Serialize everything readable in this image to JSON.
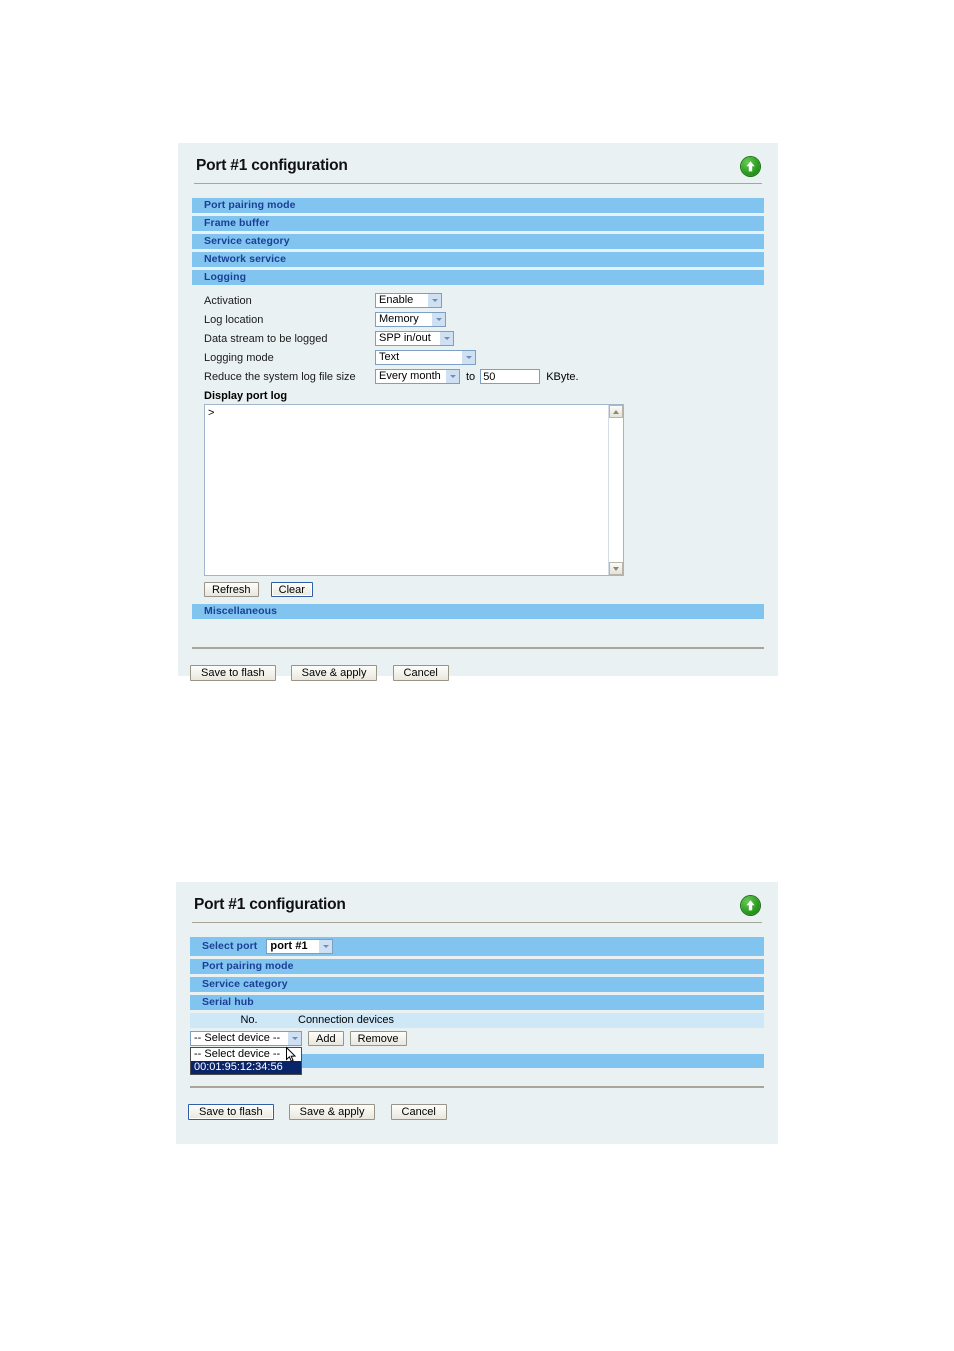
{
  "panels": {
    "logging": {
      "title": "Port #1 configuration",
      "up_icon": "up-arrow-icon",
      "sections": [
        {
          "label": "Port pairing mode"
        },
        {
          "label": "Frame buffer"
        },
        {
          "label": "Service category"
        },
        {
          "label": "Network service"
        },
        {
          "label": "Logging"
        }
      ],
      "fields": {
        "activation": {
          "label": "Activation",
          "value": "Enable"
        },
        "log_location": {
          "label": "Log location",
          "value": "Memory"
        },
        "data_stream": {
          "label": "Data stream to be logged",
          "value": "SPP in/out"
        },
        "logging_mode": {
          "label": "Logging mode",
          "value": "Text"
        },
        "reduce_size": {
          "label": "Reduce the system log file size",
          "period": "Every month",
          "to_label": "to",
          "size_value": "50",
          "unit": "KByte."
        }
      },
      "display_port_log": {
        "label": "Display port log",
        "content": ">",
        "refresh_label": "Refresh",
        "clear_label": "Clear"
      },
      "misc_section": {
        "label": "Miscellaneous"
      },
      "actions": {
        "save_to_flash": "Save to flash",
        "save_and_apply": "Save & apply",
        "cancel": "Cancel"
      }
    },
    "serialhub": {
      "title": "Port #1 configuration",
      "up_icon": "up-arrow-icon",
      "select_port": {
        "label": "Select port",
        "value": "port #1"
      },
      "sections": [
        {
          "label": "Port pairing mode"
        },
        {
          "label": "Service category"
        },
        {
          "label": "Serial hub"
        }
      ],
      "table": {
        "columns": [
          "No.",
          "Connection devices"
        ]
      },
      "device_select": {
        "value": "-- Select device --",
        "options": [
          "-- Select device --",
          "00:01:95:12:34:56"
        ],
        "selected_index": 1
      },
      "add_label": "Add",
      "remove_label": "Remove",
      "actions": {
        "save_to_flash": "Save to flash",
        "save_and_apply": "Save & apply",
        "cancel": "Cancel"
      }
    }
  }
}
